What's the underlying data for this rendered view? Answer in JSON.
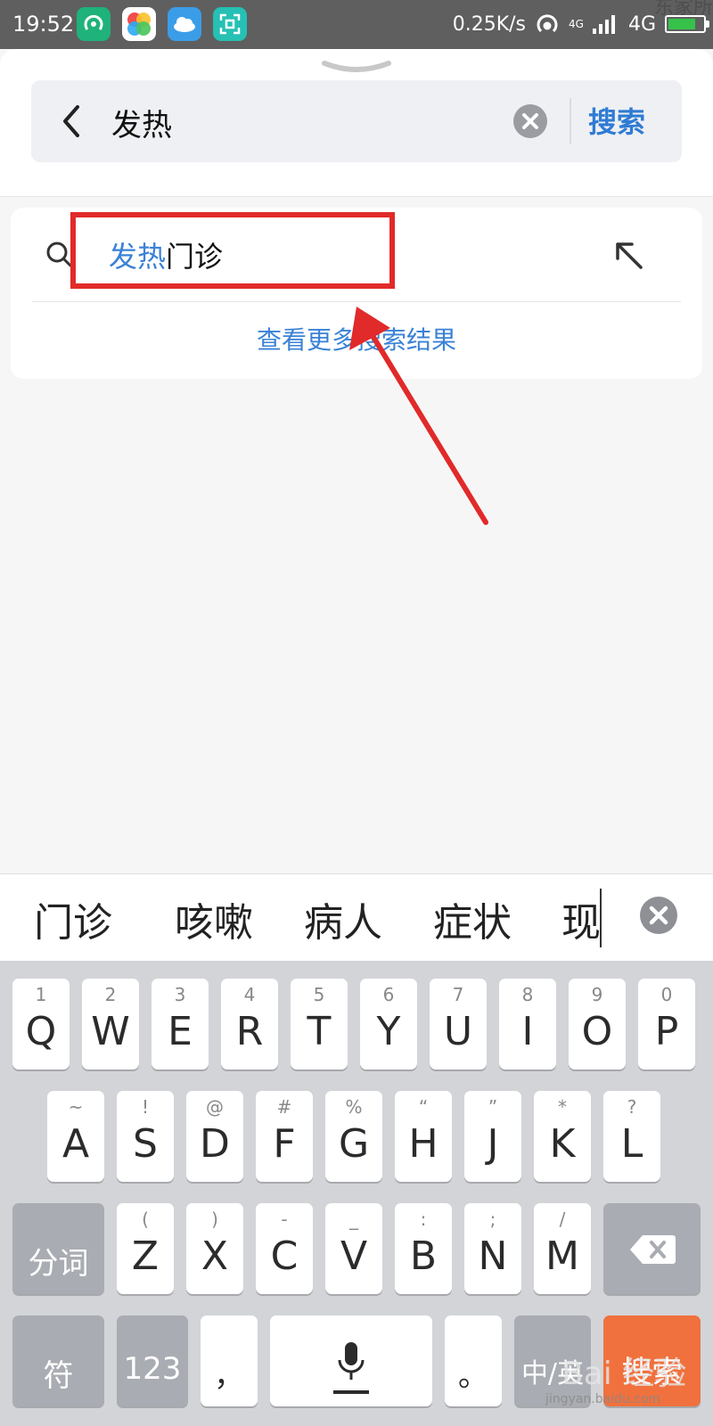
{
  "status_bar": {
    "time": "19:52",
    "net_speed": "0.25K/s",
    "signal_small": "4G",
    "signal_label": "4G",
    "corner_text": "东家所",
    "battery_level": 0.8,
    "apps": [
      "hotspot-app-icon",
      "petals-app-icon",
      "weather-app-icon",
      "scan-app-icon"
    ]
  },
  "search": {
    "query": "发热",
    "button_label": "搜索"
  },
  "suggestion": {
    "highlight": "发热",
    "rest": "门诊",
    "more_results": "查看更多搜索结果"
  },
  "candidates": [
    "门诊",
    "咳嗽",
    "病人",
    "症状",
    "现"
  ],
  "keyboard": {
    "row1": [
      {
        "hint": "1",
        "key": "Q"
      },
      {
        "hint": "2",
        "key": "W"
      },
      {
        "hint": "3",
        "key": "E"
      },
      {
        "hint": "4",
        "key": "R"
      },
      {
        "hint": "5",
        "key": "T"
      },
      {
        "hint": "6",
        "key": "Y"
      },
      {
        "hint": "7",
        "key": "U"
      },
      {
        "hint": "8",
        "key": "I"
      },
      {
        "hint": "9",
        "key": "O"
      },
      {
        "hint": "0",
        "key": "P"
      }
    ],
    "row2": [
      {
        "hint": "~",
        "key": "A"
      },
      {
        "hint": "!",
        "key": "S"
      },
      {
        "hint": "@",
        "key": "D"
      },
      {
        "hint": "#",
        "key": "F"
      },
      {
        "hint": "%",
        "key": "G"
      },
      {
        "hint": "“",
        "key": "H"
      },
      {
        "hint": "”",
        "key": "J"
      },
      {
        "hint": "*",
        "key": "K"
      },
      {
        "hint": "?",
        "key": "L"
      }
    ],
    "row3": [
      {
        "hint": "(",
        "key": "Z"
      },
      {
        "hint": ")",
        "key": "X"
      },
      {
        "hint": "-",
        "key": "C"
      },
      {
        "hint": "_",
        "key": "V"
      },
      {
        "hint": ":",
        "key": "B"
      },
      {
        "hint": ";",
        "key": "N"
      },
      {
        "hint": "/",
        "key": "M"
      }
    ],
    "segment_label": "分词",
    "symbol_label": "符",
    "number_label": "123",
    "comma_label": "，",
    "period_label": "。",
    "lang_label": "中/英",
    "action_label": "搜索"
  },
  "watermark": {
    "main": "Bai 经验",
    "sub": "jingyan.baidu.com"
  },
  "colors": {
    "accent": "#2f7bd4",
    "highlight": "#3a82d6",
    "annotation": "#e12a2a",
    "action_key": "#f0713d"
  }
}
